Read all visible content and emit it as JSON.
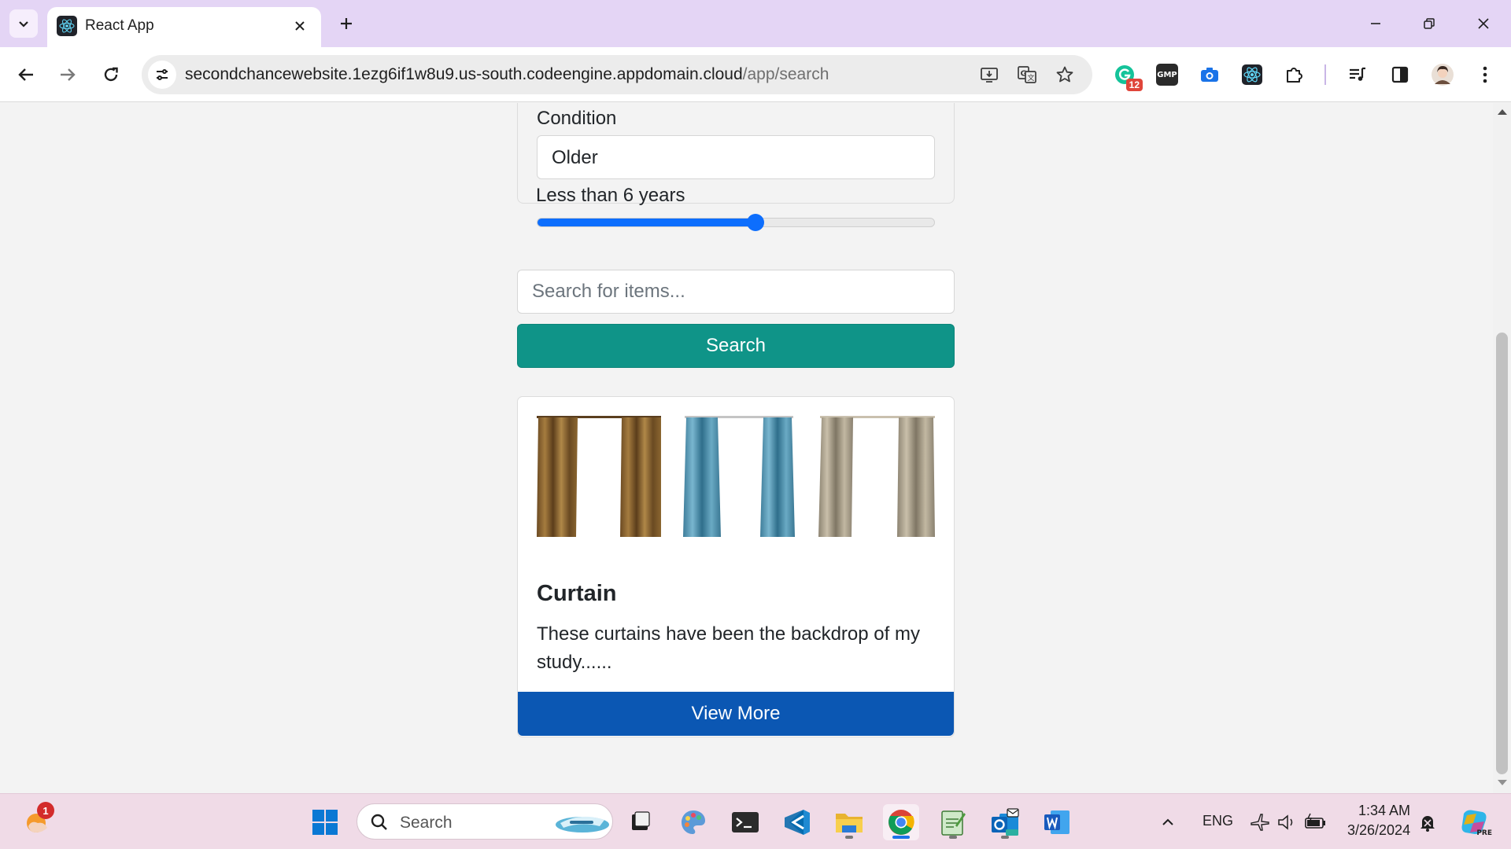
{
  "browser": {
    "tab_title": "React App",
    "url_host": "secondchancewebsite.1ezg6if1w8u9.us-south.codeengine.appdomain.cloud",
    "url_path": "/app/search",
    "extension_badge": "12",
    "extension_gmp_label": "GMP"
  },
  "filters": {
    "condition_label": "Condition",
    "condition_value": "Older",
    "age_label": "Less than 6 years",
    "age_slider_fraction": 0.55
  },
  "search": {
    "placeholder": "Search for items...",
    "button_label": "Search"
  },
  "results": [
    {
      "name": "Curtain",
      "description": "These curtains have been the backdrop of my study......",
      "button_label": "View More"
    }
  ],
  "taskbar": {
    "search_label": "Search",
    "notification_count": "1",
    "language": "ENG",
    "time": "1:34 AM",
    "date": "3/26/2024",
    "copilot_badge": "PRE"
  },
  "colors": {
    "search_button": "#0f9488",
    "view_more_button": "#0b57b3",
    "slider": "#0d6efd",
    "tabstrip": "#e4d5f5",
    "taskbar": "#f0dbe7"
  }
}
